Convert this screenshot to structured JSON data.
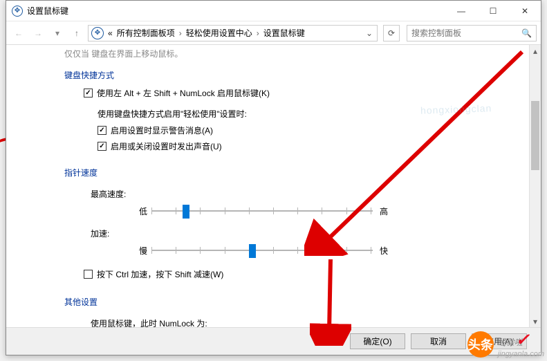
{
  "window": {
    "title": "设置鼠标键"
  },
  "nav": {
    "breadcrumb_prefix": "«",
    "crumbs": [
      "所有控制面板项",
      "轻松使用设置中心",
      "设置鼠标键"
    ],
    "search_placeholder": "搜索控制面板"
  },
  "cutoff_text": "仅仅当 键盘在界面上移动鼠标。",
  "sections": {
    "keyboard_shortcut": {
      "heading": "键盘快捷方式",
      "chk_enable": {
        "checked": true,
        "label": "使用左 Alt + 左 Shift + NumLock 启用鼠标键(K)"
      },
      "sub_intro": "使用键盘快捷方式启用\"轻松使用\"设置时:",
      "chk_warn": {
        "checked": true,
        "label": "启用设置时显示警告消息(A)"
      },
      "chk_sound": {
        "checked": true,
        "label": "启用或关闭设置时发出声音(U)"
      }
    },
    "pointer_speed": {
      "heading": "指针速度",
      "max_speed_label": "最高速度:",
      "slider1": {
        "low": "低",
        "high": "高",
        "value_pct": 14
      },
      "accel_label": "加速:",
      "slider2": {
        "low": "慢",
        "high": "快",
        "value_pct": 44
      },
      "chk_ctrl_shift": {
        "checked": false,
        "label": "按下 Ctrl 加速，按下 Shift 减速(W)"
      }
    },
    "other": {
      "heading": "其他设置",
      "numlock_label": "使用鼠标键，此时 NumLock 为:"
    }
  },
  "buttons": {
    "ok": "确定(O)",
    "cancel": "取消",
    "apply": "应用(A)"
  },
  "watermark": {
    "badge": "头条",
    "text": "经验啦",
    "url": "jingyanla.com"
  },
  "faint_watermark": "hongxiongclan"
}
